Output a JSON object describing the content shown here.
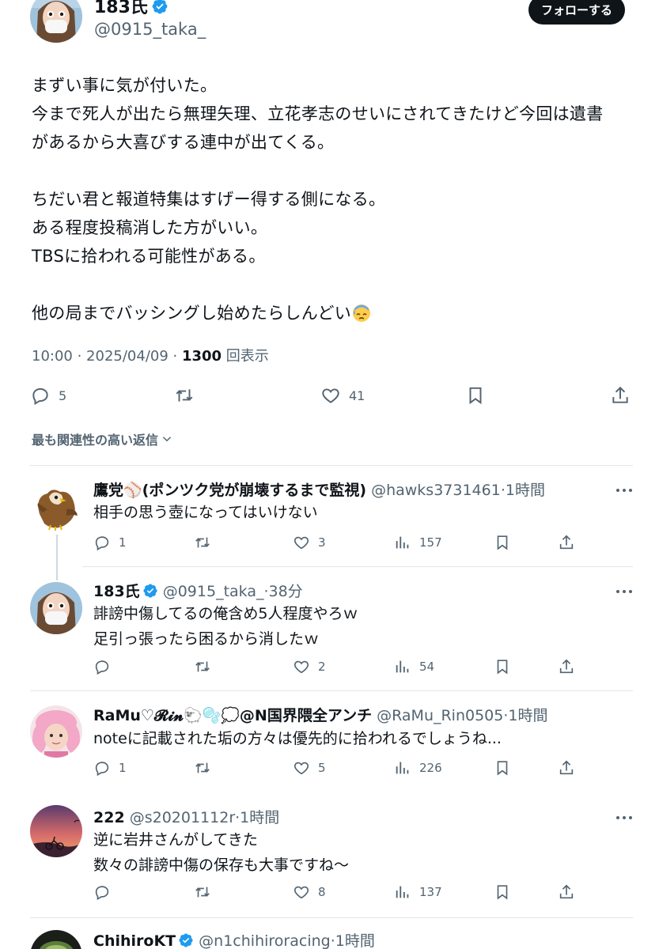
{
  "main": {
    "author_name": "183氏",
    "author_handle": "@0915_taka_",
    "follow_label": "フォローする",
    "text_lines": [
      "まずい事に気が付いた。",
      "今まで死人が出たら無理矢理、立花孝志のせいにされてきたけど今回は遺書",
      "があるから大喜びする連中が出てくる。",
      "",
      "ちだい君と報道特集はすげー得する側になる。",
      "ある程度投稿消した方がいい。",
      "TBSに拾われる可能性がある。",
      "",
      "他の局までバッシングし始めたらしんどい"
    ],
    "time": "10:00 · 2025/04/09 · ",
    "views_count": "1300",
    "views_label": " 回表示",
    "replies": "5",
    "likes": "41"
  },
  "sort_label": "最も関連性の高い返信",
  "replies": [
    {
      "name": "鷹党⚾(ポンツク党が崩壊するまで監視)",
      "handle": " @hawks3731461·1時間",
      "lines": [
        "相手の思う壺になってはいけない"
      ],
      "replies": "1",
      "reposts": "",
      "likes": "3",
      "views": "157"
    },
    {
      "name": "183氏",
      "handle": " @0915_taka_·38分",
      "lines": [
        "誹謗中傷してるの俺含め5人程度やろｗ",
        "足引っ張ったら困るから消したｗ"
      ],
      "replies": "",
      "reposts": "",
      "likes": "2",
      "views": "54"
    },
    {
      "name": "RaMu♡𝓡𝓲𝓷🐑🫧💭@N国界隈全アンチ",
      "handle": " @RaMu_Rin0505·1時間",
      "lines": [
        "noteに記載された垢の方々は優先的に拾われるでしょうね..."
      ],
      "replies": "1",
      "reposts": "",
      "likes": "5",
      "views": "226"
    },
    {
      "name": "222",
      "handle": " @s20201112r·1時間",
      "lines": [
        "逆に岩井さんがしてきた",
        "数々の誹謗中傷の保存も大事ですね〜"
      ],
      "replies": "",
      "reposts": "",
      "likes": "8",
      "views": "137"
    },
    {
      "name": "ChihiroKT",
      "handle": " @n1chihiroracing·1時間",
      "lines": [],
      "replies": "",
      "reposts": "",
      "likes": "",
      "views": ""
    }
  ],
  "colors": {
    "verified": "#1d9bf0",
    "secondary": "#536471",
    "primary": "#0f1419",
    "divider": "#e1e6ea"
  }
}
